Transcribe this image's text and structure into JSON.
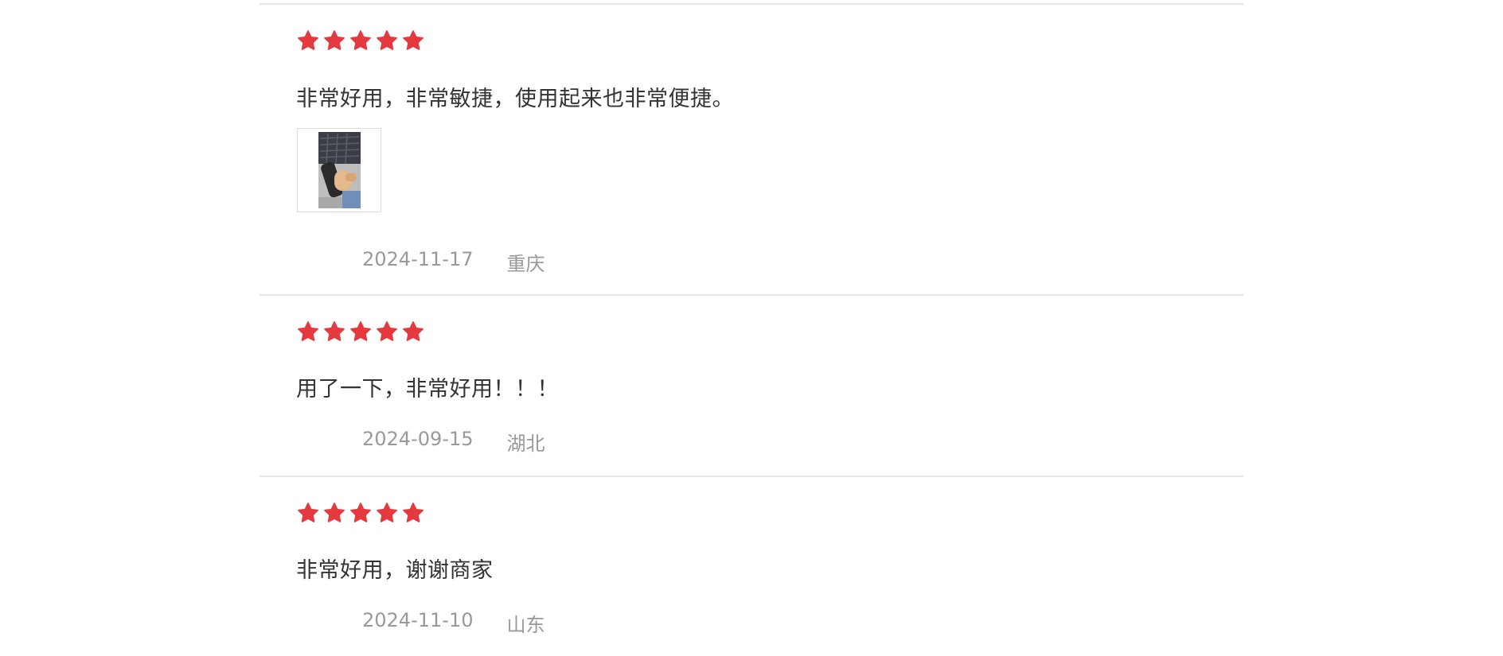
{
  "colors": {
    "star": "#e53940",
    "text": "#333333",
    "meta": "#999999",
    "divider": "#e5e5e5"
  },
  "reviews": [
    {
      "rating": 5,
      "content": "非常好用，非常敏捷，使用起来也非常便捷。",
      "date": "2024-11-17",
      "location": "重庆",
      "has_image": true
    },
    {
      "rating": 5,
      "content": "用了一下，非常好用！！！",
      "date": "2024-09-15",
      "location": "湖北",
      "has_image": false
    },
    {
      "rating": 5,
      "content": "非常好用，谢谢商家",
      "date": "2024-11-10",
      "location": "山东",
      "has_image": false
    }
  ]
}
